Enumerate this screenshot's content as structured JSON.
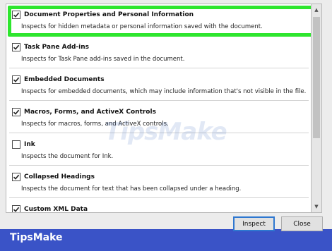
{
  "items": [
    {
      "title": "Document Properties and Personal Information",
      "description": "Inspects for hidden metadata or personal information saved with the document.",
      "checked": true
    },
    {
      "title": "Task Pane Add-ins",
      "description": "Inspects for Task Pane add-ins saved in the document.",
      "checked": true
    },
    {
      "title": "Embedded Documents",
      "description": "Inspects for embedded documents, which may include information that's not visible in the file.",
      "checked": true
    },
    {
      "title": "Macros, Forms, and ActiveX Controls",
      "description": "Inspects for macros, forms, and ActiveX controls.",
      "checked": true
    },
    {
      "title": "Ink",
      "description": "Inspects the document for Ink.",
      "checked": false
    },
    {
      "title": "Collapsed Headings",
      "description": "Inspects the document for text that has been collapsed under a heading.",
      "checked": true
    },
    {
      "title": "Custom XML Data",
      "description": "",
      "checked": true
    }
  ],
  "buttons": {
    "inspect": "Inspect",
    "close": "Close"
  },
  "brand": "TipsMake",
  "watermark": "TipsMake",
  "colors": {
    "highlight": "#2ee62e",
    "footer": "#3a53c7"
  }
}
